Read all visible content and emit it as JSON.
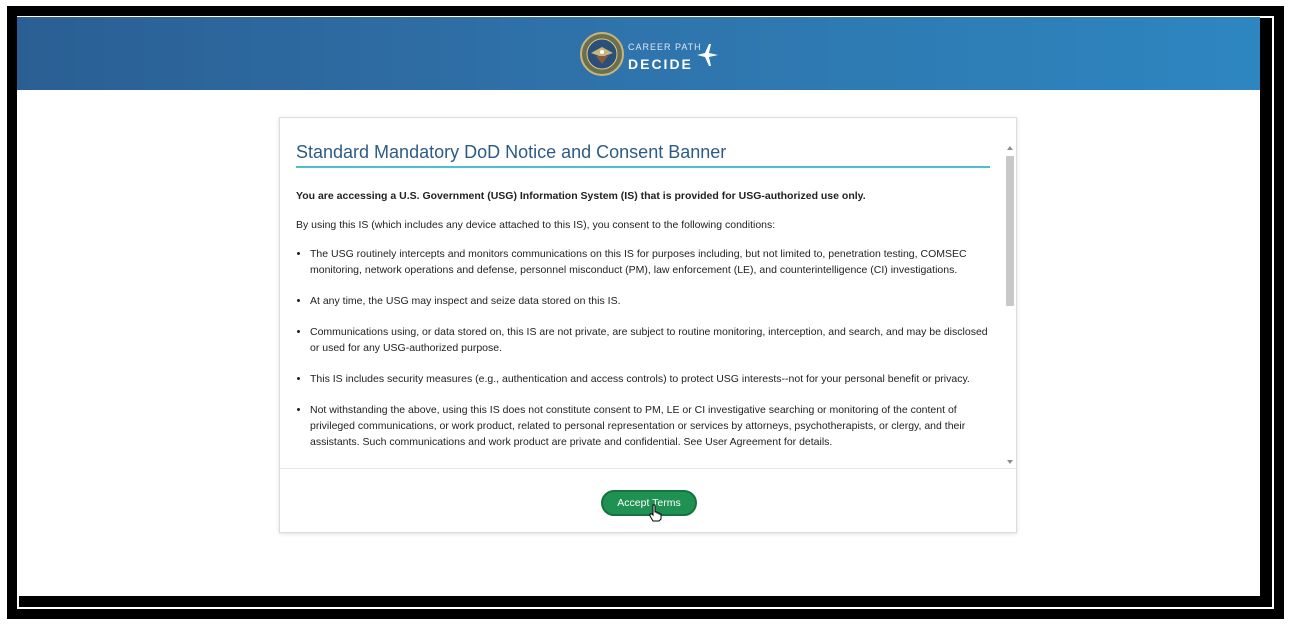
{
  "header": {
    "brand_small": "CAREER PATH",
    "brand_big": "DECIDE",
    "logo_icon": "dod-seal-icon",
    "plane_icon": "plane-icon",
    "colors": {
      "start": "#2a5f93",
      "end": "#2e86c0"
    }
  },
  "banner": {
    "title": "Standard Mandatory DoD Notice and Consent Banner",
    "lead": "You are accessing a U.S. Government (USG) Information System (IS) that is provided for USG-authorized use only.",
    "intro": "By using this IS (which includes any device attached to this IS), you consent to the following conditions:",
    "items": [
      "The USG routinely intercepts and monitors communications on this IS for purposes including, but not limited to, penetration testing, COMSEC monitoring, network operations and defense, personnel misconduct (PM), law enforcement (LE), and counterintelligence (CI) investigations.",
      "At any time, the USG may inspect and seize data stored on this IS.",
      "Communications using, or data stored on, this IS are not private, are subject to routine monitoring, interception, and search, and may be disclosed or used for any USG-authorized purpose.",
      "This IS includes security measures (e.g., authentication and access controls) to protect USG interests--not for your personal benefit or privacy.",
      "Not withstanding the above, using this IS does not constitute consent to PM, LE or CI investigative searching or monitoring of the content of privileged communications, or work product, related to personal representation or services by attorneys, psychotherapists, or clergy, and their assistants. Such communications and work product are private and confidential. See User Agreement for details."
    ],
    "accent_color": "#4cc0cf"
  },
  "actions": {
    "accept_label": "Accept Terms",
    "accept_color": "#1f9152"
  }
}
